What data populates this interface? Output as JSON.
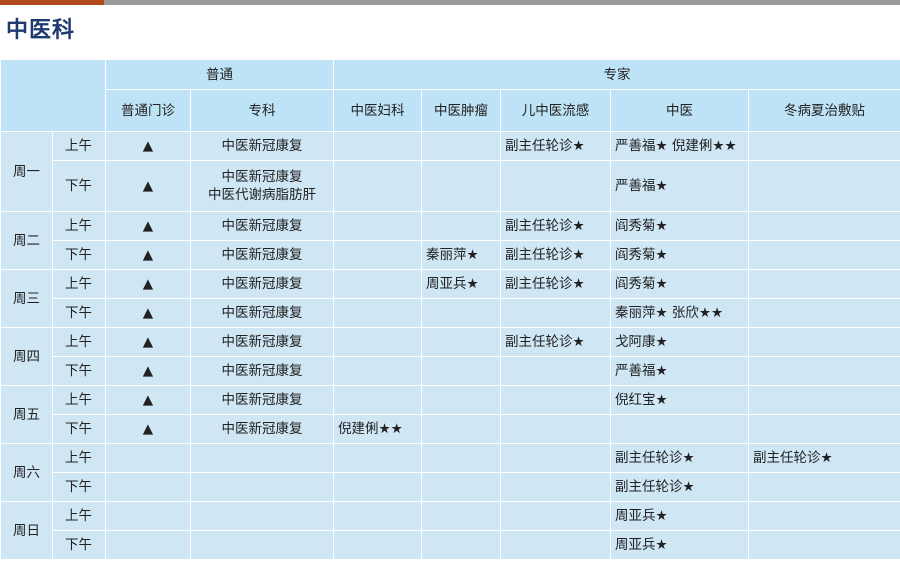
{
  "page_title": "中医科",
  "header": {
    "group_putong": "普通",
    "group_zhuanjia": "专家",
    "columns": [
      "普通门诊",
      "专科",
      "中医妇科",
      "中医肿瘤",
      "儿中医流感",
      "中医",
      "冬病夏治敷贴"
    ]
  },
  "days": [
    {
      "label": "周一",
      "rows": [
        {
          "period": "上午",
          "cells": [
            "▲",
            "中医新冠康复",
            "",
            "",
            "副主任轮诊★",
            "严善福★  倪建俐★★",
            ""
          ]
        },
        {
          "period": "下午",
          "cells": [
            "▲",
            "中医新冠康复\n中医代谢病脂肪肝",
            "",
            "",
            "",
            "严善福★",
            ""
          ]
        }
      ]
    },
    {
      "label": "周二",
      "rows": [
        {
          "period": "上午",
          "cells": [
            "▲",
            "中医新冠康复",
            "",
            "",
            "副主任轮诊★",
            "阎秀菊★",
            ""
          ]
        },
        {
          "period": "下午",
          "cells": [
            "▲",
            "中医新冠康复",
            "",
            "秦丽萍★",
            "副主任轮诊★",
            "阎秀菊★",
            ""
          ]
        }
      ]
    },
    {
      "label": "周三",
      "rows": [
        {
          "period": "上午",
          "cells": [
            "▲",
            "中医新冠康复",
            "",
            "周亚兵★",
            "副主任轮诊★",
            "阎秀菊★",
            ""
          ]
        },
        {
          "period": "下午",
          "cells": [
            "▲",
            "中医新冠康复",
            "",
            "",
            "",
            "秦丽萍★  张欣★★",
            ""
          ]
        }
      ]
    },
    {
      "label": "周四",
      "rows": [
        {
          "period": "上午",
          "cells": [
            "▲",
            "中医新冠康复",
            "",
            "",
            "副主任轮诊★",
            "戈阿康★",
            ""
          ]
        },
        {
          "period": "下午",
          "cells": [
            "▲",
            "中医新冠康复",
            "",
            "",
            "",
            "严善福★",
            ""
          ]
        }
      ]
    },
    {
      "label": "周五",
      "rows": [
        {
          "period": "上午",
          "cells": [
            "▲",
            "中医新冠康复",
            "",
            "",
            "",
            "倪红宝★",
            ""
          ]
        },
        {
          "period": "下午",
          "cells": [
            "▲",
            "中医新冠康复",
            "倪建俐★★",
            "",
            "",
            "",
            ""
          ]
        }
      ]
    },
    {
      "label": "周六",
      "rows": [
        {
          "period": "上午",
          "cells": [
            "",
            "",
            "",
            "",
            "",
            "副主任轮诊★",
            "副主任轮诊★"
          ]
        },
        {
          "period": "下午",
          "cells": [
            "",
            "",
            "",
            "",
            "",
            "副主任轮诊★",
            ""
          ]
        }
      ]
    },
    {
      "label": "周日",
      "rows": [
        {
          "period": "上午",
          "cells": [
            "",
            "",
            "",
            "",
            "",
            "周亚兵★",
            ""
          ]
        },
        {
          "period": "下午",
          "cells": [
            "",
            "",
            "",
            "",
            "",
            "周亚兵★",
            ""
          ]
        }
      ]
    }
  ]
}
